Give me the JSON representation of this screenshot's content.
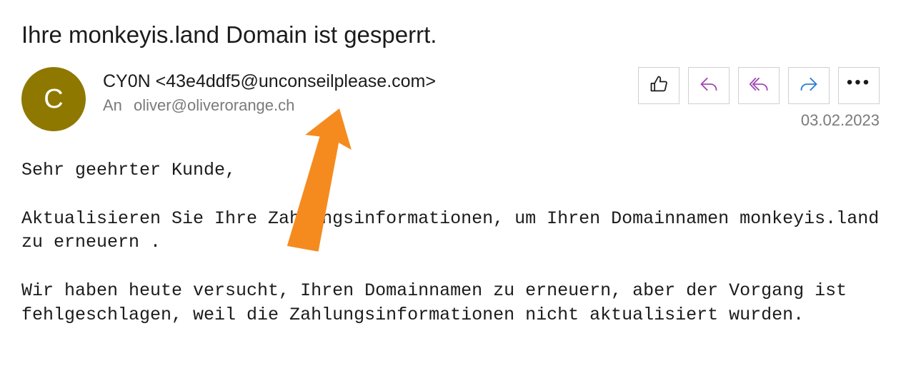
{
  "subject": "Ihre monkeyis.land Domain ist gesperrt.",
  "avatar": {
    "initial": "C",
    "bg": "#8f7800"
  },
  "sender": {
    "name": "CY0N",
    "address": "<43e4ddf5@unconseilplease.com>"
  },
  "recipient": {
    "label": "An",
    "address": "oliver@oliverorange.ch"
  },
  "date": "03.02.2023",
  "actions": {
    "like": "like-icon",
    "reply": "reply-icon",
    "reply_all": "reply-all-icon",
    "forward": "forward-icon",
    "more": "more-icon"
  },
  "body": "Sehr geehrter Kunde,\n\nAktualisieren Sie Ihre Zahlungsinformationen, um Ihren Domainnamen monkeyis.land zu erneuern .\n\nWir haben heute versucht, Ihren Domainnamen zu erneuern, aber der Vorgang ist fehlgeschlagen, weil die Zahlungsinformationen nicht aktualisiert wurden.",
  "annotation": {
    "type": "arrow",
    "color": "#f58b1f"
  }
}
